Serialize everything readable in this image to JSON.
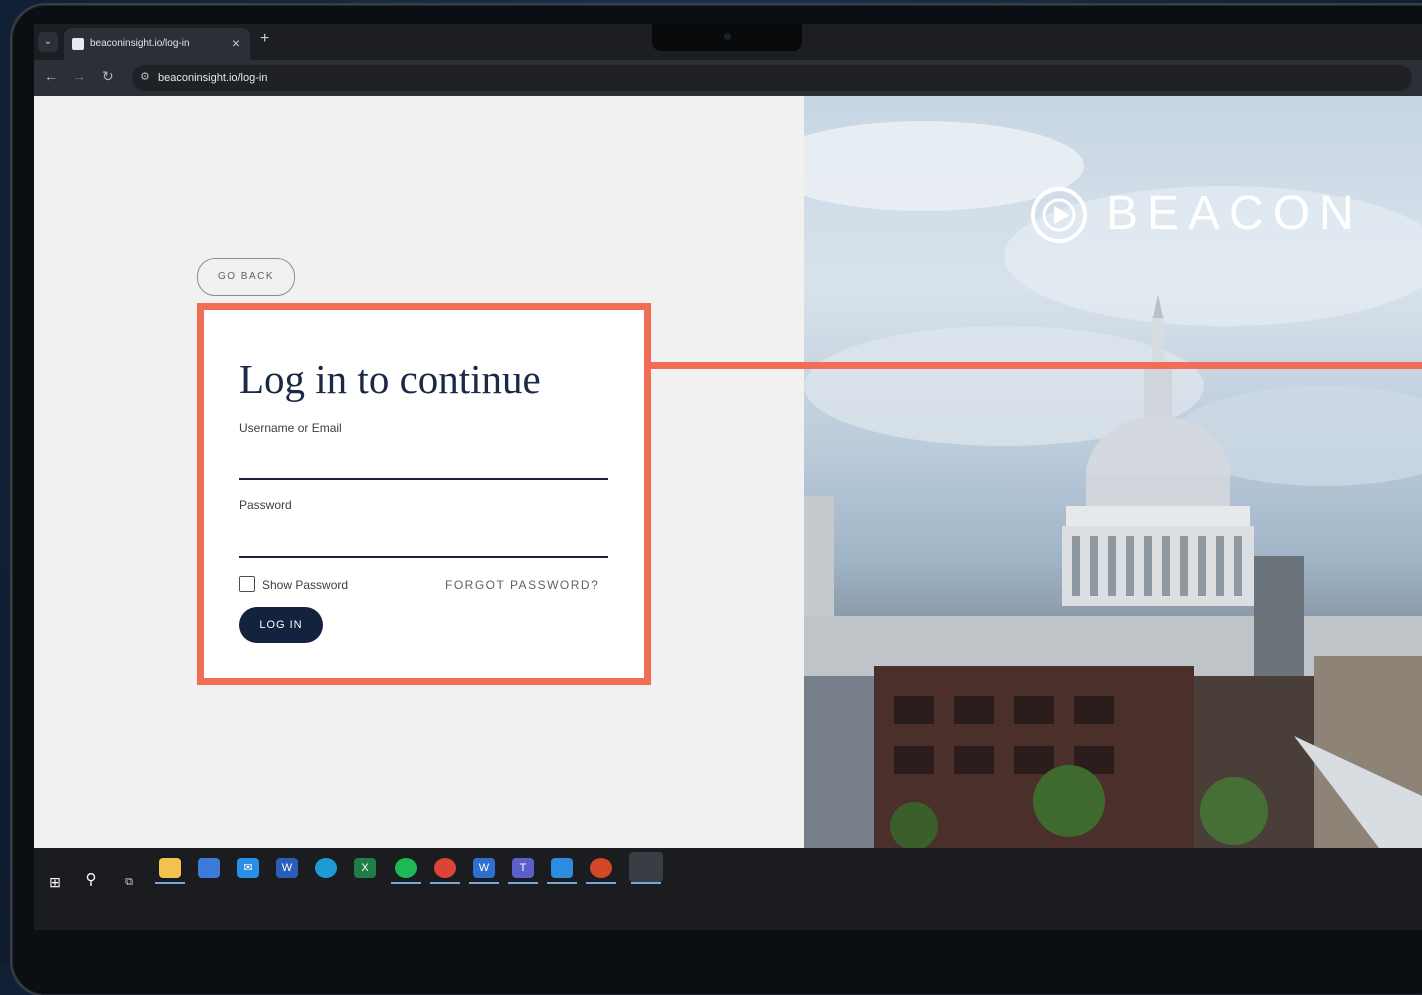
{
  "browser": {
    "tab_title": "beaconinsight.io/log-in",
    "url": "beaconinsight.io/log-in",
    "tab_menu_icon": "chevron-down-icon",
    "new_tab_label": "+",
    "close_label": "×"
  },
  "login": {
    "go_back_label": "GO BACK",
    "heading": "Log in to continue",
    "username_label": "Username or Email",
    "username_value": "",
    "password_label": "Password",
    "password_value": "",
    "show_password_label": "Show Password",
    "show_password_checked": false,
    "forgot_label": "FORGOT PASSWORD?",
    "login_button_label": "LOG IN"
  },
  "brand": {
    "wordmark": "BEACON"
  },
  "taskbar": {
    "icons": [
      "windows-start-icon",
      "search-icon",
      "task-view-icon",
      "file-explorer-icon",
      "store-icon",
      "mail-icon",
      "word-icon",
      "edge-icon",
      "excel-icon",
      "spotify-icon",
      "chrome-icon",
      "webex-icon",
      "teams-icon",
      "paint-icon",
      "powerpoint-icon",
      "chrome-profile-icon"
    ]
  },
  "colors": {
    "accent": "#f26d55",
    "primary_button": "#14233d",
    "heading": "#1a2a44"
  }
}
